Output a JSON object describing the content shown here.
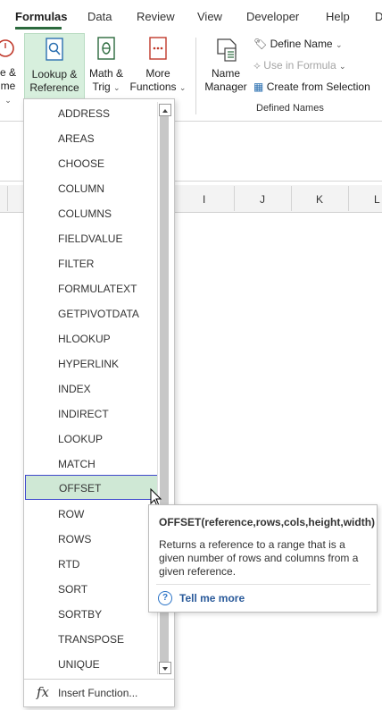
{
  "tabs": [
    "Formulas",
    "Data",
    "Review",
    "View",
    "Developer",
    "Help",
    "D"
  ],
  "ribbon": {
    "partial_btn_line1": "e &",
    "partial_btn_line2": "me",
    "lookup_line1": "Lookup &",
    "lookup_line2": "Reference",
    "math_line1": "Math &",
    "math_line2": "Trig",
    "more_line1": "More",
    "more_line2": "Functions",
    "name_manager_line1": "Name",
    "name_manager_line2": "Manager",
    "define_name": "Define Name",
    "use_in_formula": "Use in Formula",
    "create_from_selection": "Create from Selection",
    "group_defined_names": "Defined Names"
  },
  "columns": [
    "I",
    "J",
    "K",
    "L"
  ],
  "menu": {
    "items": [
      "ADDRESS",
      "AREAS",
      "CHOOSE",
      "COLUMN",
      "COLUMNS",
      "FIELDVALUE",
      "FILTER",
      "FORMULATEXT",
      "GETPIVOTDATA",
      "HLOOKUP",
      "HYPERLINK",
      "INDEX",
      "INDIRECT",
      "LOOKUP",
      "MATCH",
      "OFFSET",
      "ROW",
      "ROWS",
      "RTD",
      "SORT",
      "SORTBY",
      "TRANSPOSE",
      "UNIQUE"
    ],
    "selected": "OFFSET",
    "insert_function": "Insert Function..."
  },
  "tooltip": {
    "title": "OFFSET(reference,rows,cols,height,width)",
    "body": "Returns a reference to a range that is a given number of rows and columns from a given reference.",
    "link": "Tell me more"
  },
  "colors": {
    "accent": "#2b6a3d",
    "selection_fill": "#cfe8d5",
    "selection_border": "#3f48cc",
    "link": "#2a5a9a"
  }
}
